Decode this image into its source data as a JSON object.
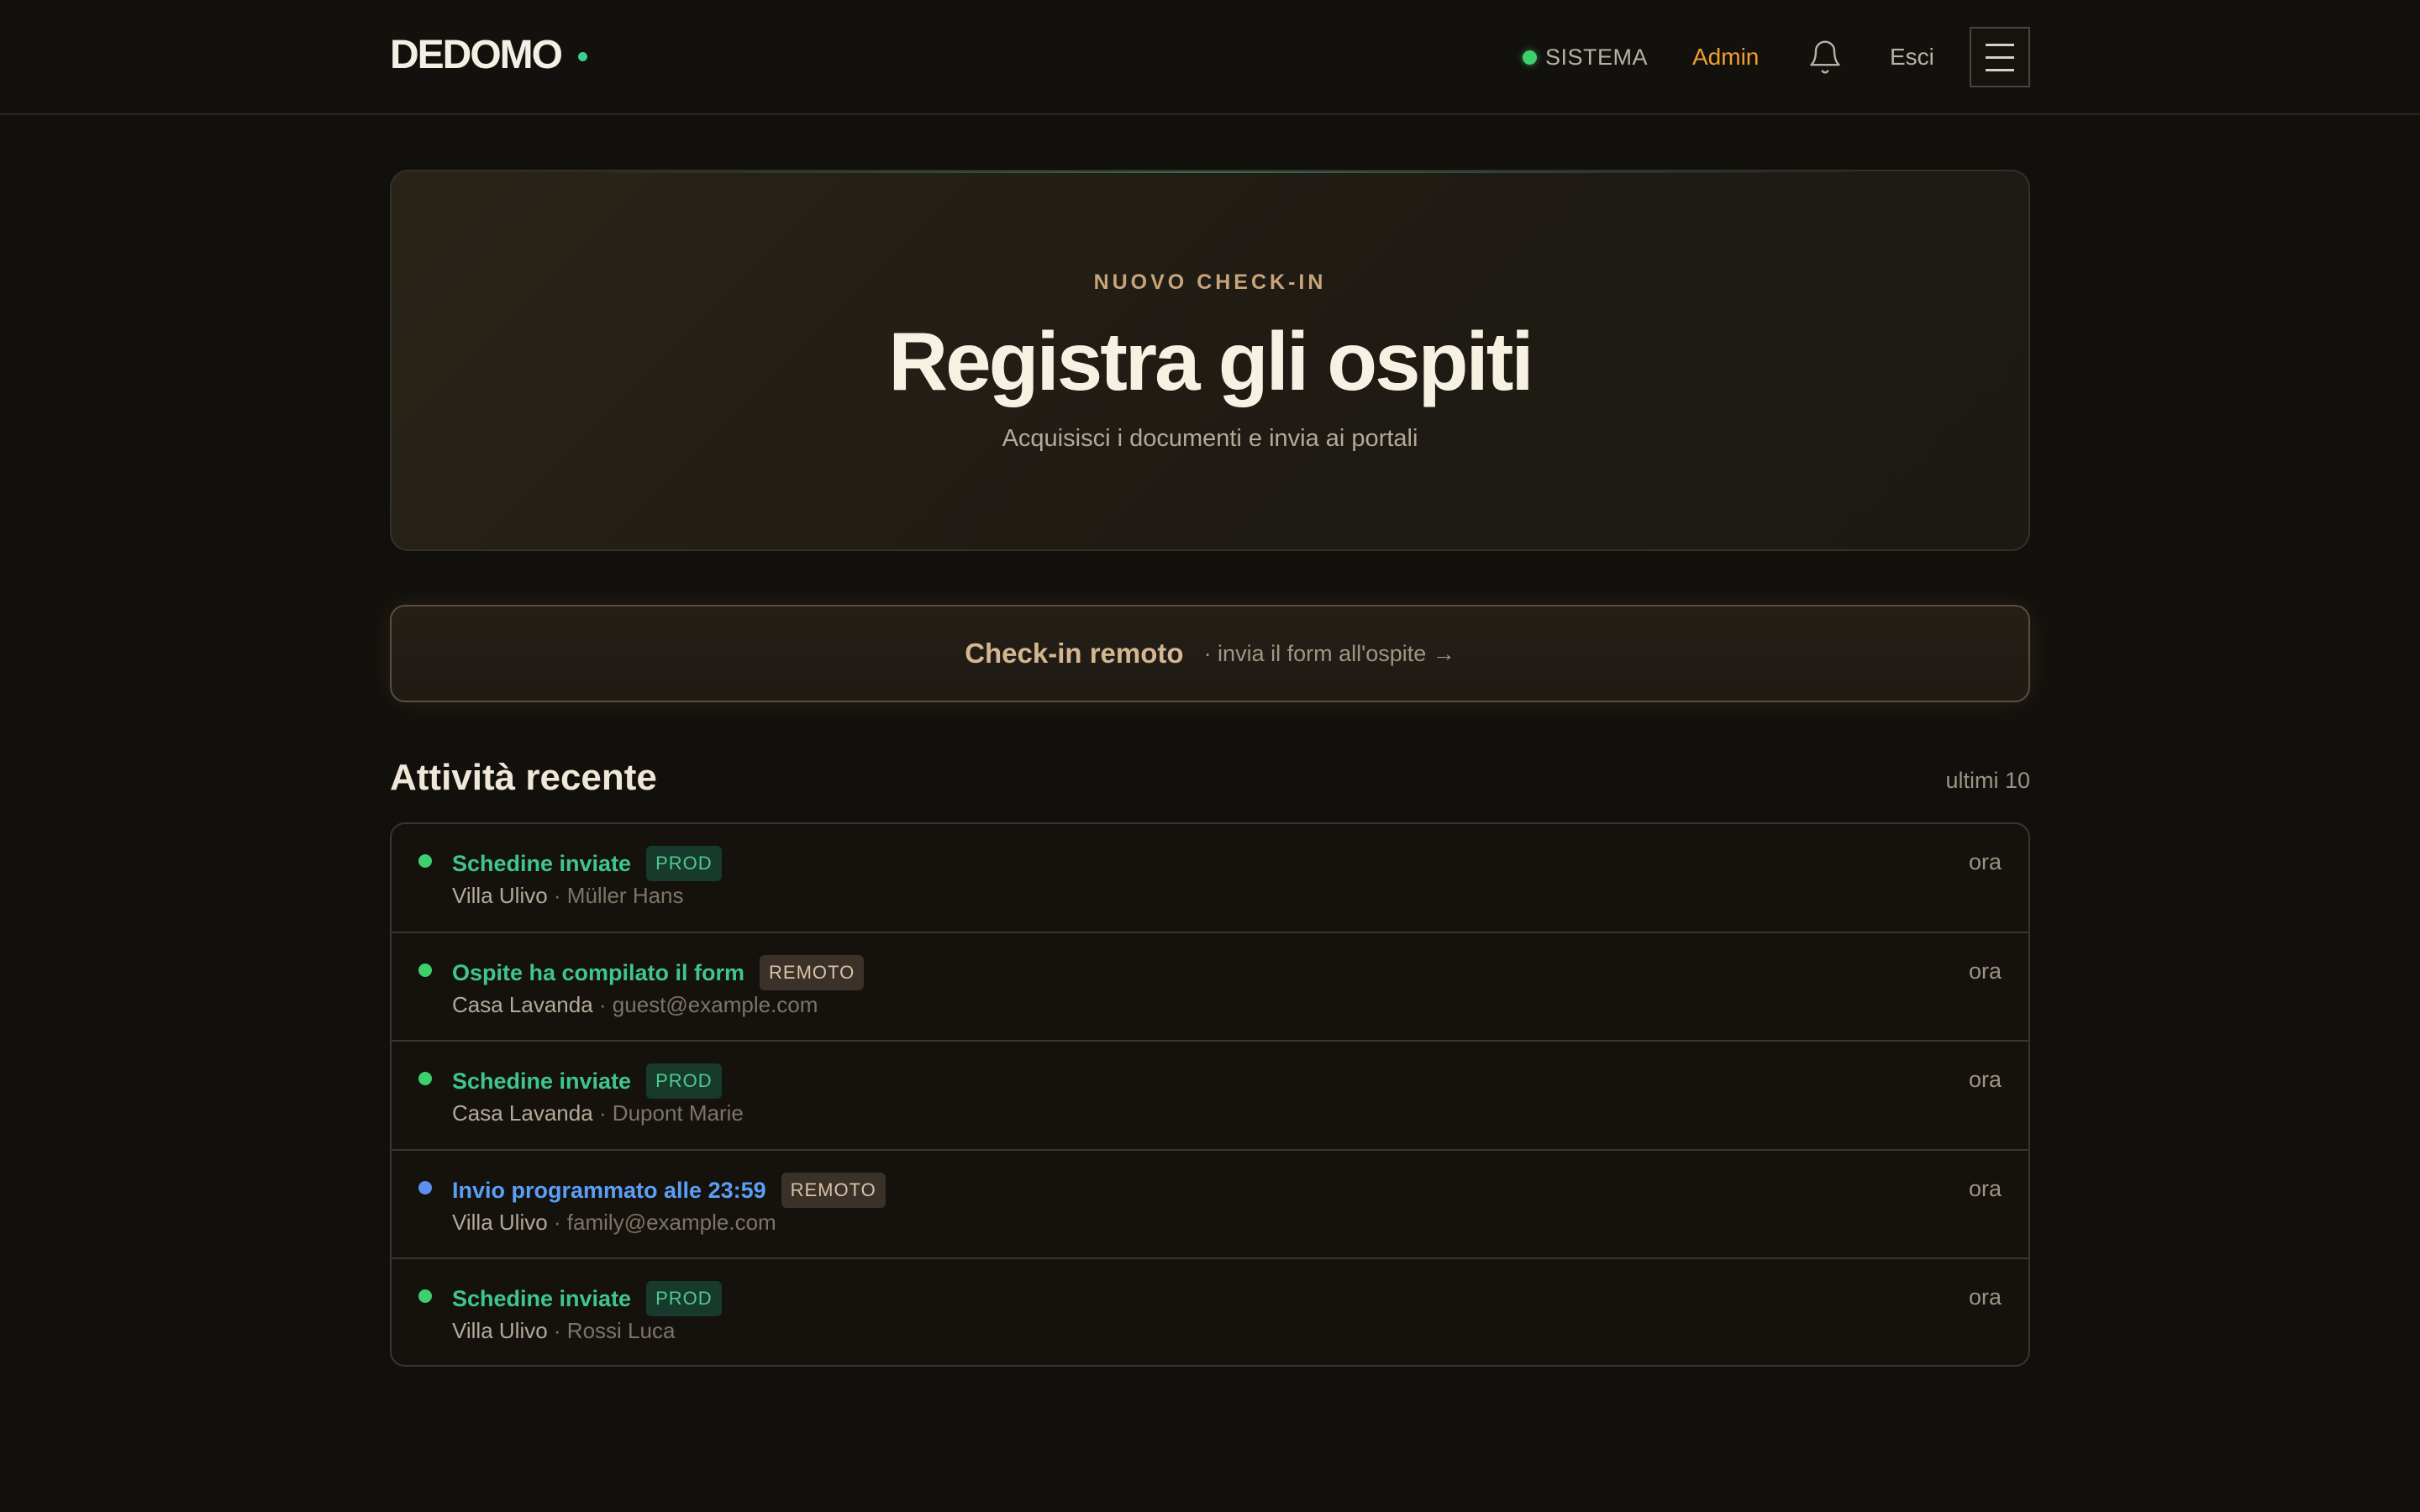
{
  "header": {
    "logo": "DEDOMO",
    "status_label": "SISTEMA",
    "status_color": "#3ecf6e",
    "admin_link": "Admin",
    "logout": "Esci",
    "icons": [
      "bell-icon",
      "hamburger-menu-icon"
    ]
  },
  "hero": {
    "kicker": "NUOVO CHECK-IN",
    "title": "Registra gli ospiti",
    "subtitle": "Acquisisci i documenti e invia ai portali"
  },
  "remote": {
    "title": "Check-in remoto",
    "subtitle": "· invia il form all'ospite →"
  },
  "activity": {
    "title": "Attività recente",
    "meta": "ultimi 10",
    "items": [
      {
        "title": "Schedine inviate",
        "title_color": "#3fc58e",
        "dot_color": "#3ecf6e",
        "badge": "PROD",
        "badge_type": "prod",
        "place": "Villa Ulivo",
        "who": "· Müller Hans",
        "time": "ora"
      },
      {
        "title": "Ospite ha compilato il form",
        "title_color": "#3fc58e",
        "dot_color": "#3ecf6e",
        "badge": "REMOTO",
        "badge_type": "remoto",
        "place": "Casa Lavanda",
        "who": "· guest@example.com",
        "time": "ora"
      },
      {
        "title": "Schedine inviate",
        "title_color": "#3fc58e",
        "dot_color": "#3ecf6e",
        "badge": "PROD",
        "badge_type": "prod",
        "place": "Casa Lavanda",
        "who": "· Dupont Marie",
        "time": "ora"
      },
      {
        "title": "Invio programmato alle 23:59",
        "title_color": "#5b9ef5",
        "dot_color": "#5b8ff0",
        "badge": "REMOTO",
        "badge_type": "remoto",
        "place": "Villa Ulivo",
        "who": "· family@example.com",
        "time": "ora"
      },
      {
        "title": "Schedine inviate",
        "title_color": "#3fc58e",
        "dot_color": "#3ecf6e",
        "badge": "PROD",
        "badge_type": "prod",
        "place": "Villa Ulivo",
        "who": "· Rossi Luca",
        "time": "ora"
      }
    ]
  }
}
